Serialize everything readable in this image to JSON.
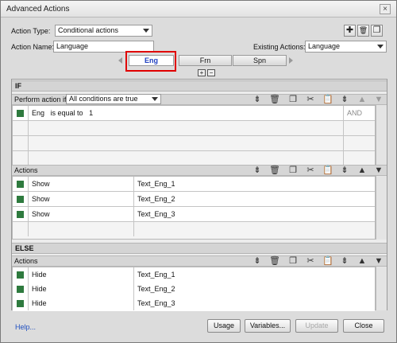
{
  "window": {
    "title": "Advanced Actions",
    "close_glyph": "×"
  },
  "header": {
    "action_type_label": "Action Type:",
    "action_type_value": "Conditional actions",
    "action_name_label": "Action Name:",
    "action_name_value": "Language",
    "existing_actions_label": "Existing Actions:",
    "existing_actions_value": "Language",
    "toolbar": {
      "add_glyph": "✚",
      "delete_glyph": "🗑",
      "duplicate_glyph": "❐"
    }
  },
  "tabs": [
    {
      "label": "Eng"
    },
    {
      "label": "Frn"
    },
    {
      "label": "Spn"
    }
  ],
  "tab_controls": {
    "add_glyph": "+",
    "remove_glyph": "−"
  },
  "if_section": {
    "title": "IF",
    "perform_label": "Perform action if:",
    "perform_value": "All conditions are true",
    "conditions": [
      {
        "variable": "Eng",
        "operator": "is equal to",
        "value": "1",
        "logic": "AND"
      }
    ]
  },
  "if_actions": {
    "title": "Actions",
    "rows": [
      {
        "action": "Show",
        "target": "Text_Eng_1"
      },
      {
        "action": "Show",
        "target": "Text_Eng_2"
      },
      {
        "action": "Show",
        "target": "Text_Eng_3"
      }
    ]
  },
  "else_section": {
    "title": "ELSE"
  },
  "else_actions": {
    "title": "Actions",
    "rows": [
      {
        "action": "Hide",
        "target": "Text_Eng_1"
      },
      {
        "action": "Hide",
        "target": "Text_Eng_2"
      },
      {
        "action": "Hide",
        "target": "Text_Eng_3"
      }
    ]
  },
  "toolbar_glyphs": {
    "insert": "⇟",
    "delete": "🗑",
    "copy": "❐",
    "cut": "✂",
    "paste": "📋",
    "move_up": "▲",
    "move_down": "▼"
  },
  "footer": {
    "help_link": "Help...",
    "usage_button": "Usage",
    "variables_button": "Variables...",
    "update_button": "Update",
    "close_button": "Close"
  },
  "colors": {
    "highlight": "#e00000",
    "row_marker": "#2e7a3e",
    "active_tab_text": "#2040c0"
  }
}
